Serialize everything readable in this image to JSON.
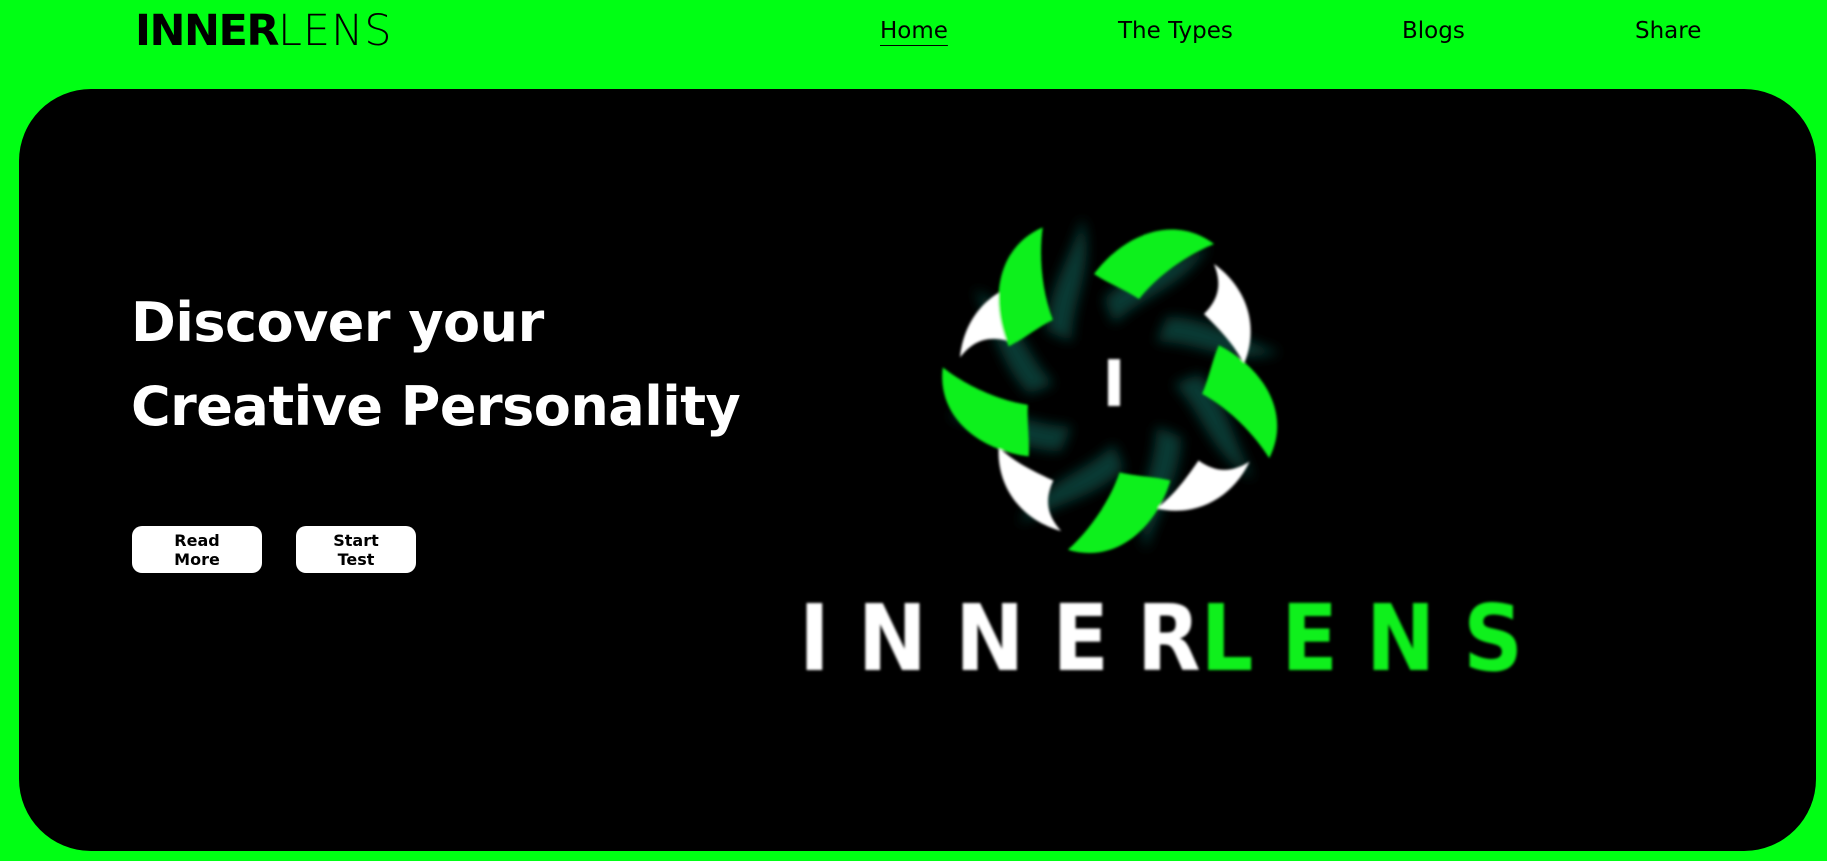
{
  "brand": {
    "bold": "INNER",
    "thin": "LENS"
  },
  "nav": {
    "home": "Home",
    "types": "The Types",
    "blogs": "Blogs",
    "share": "Share"
  },
  "hero": {
    "line1": "Discover your",
    "line2": "Creative Personality",
    "read_more": "Read More",
    "start_test": "Start Test"
  },
  "logo": {
    "center_letter": "I",
    "word_white": [
      "I",
      "N",
      "N",
      "E",
      "R"
    ],
    "word_green": [
      "L",
      "E",
      "N",
      "S"
    ]
  },
  "colors": {
    "background": "#00ff14",
    "hero": "#000000",
    "accent": "#0ff01c",
    "text_light": "#ffffff"
  }
}
